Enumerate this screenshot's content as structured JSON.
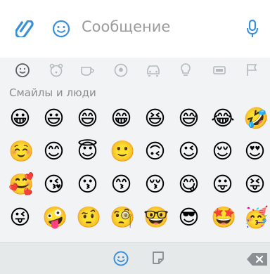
{
  "message_bar": {
    "placeholder": "Сообщение",
    "icons": [
      "paperclip-icon",
      "smile-icon",
      "microphone-icon"
    ],
    "accent_color": "#3a8fd9"
  },
  "categories": [
    {
      "name": "smileys",
      "active": true
    },
    {
      "name": "animals",
      "active": false
    },
    {
      "name": "food",
      "active": false
    },
    {
      "name": "activity",
      "active": false
    },
    {
      "name": "travel",
      "active": false
    },
    {
      "name": "objects",
      "active": false
    },
    {
      "name": "symbols",
      "active": false
    },
    {
      "name": "flags",
      "active": false
    }
  ],
  "section": {
    "title": "Смайлы и люди"
  },
  "emojis": [
    [
      "😀",
      "😃",
      "😄",
      "😁",
      "😆",
      "😅",
      "😂",
      "🤣"
    ],
    [
      "☺️",
      "😊",
      "😇",
      "🙂",
      "🙃",
      "😉",
      "😌",
      "😍"
    ],
    [
      "🥰",
      "😘",
      "😗",
      "😙",
      "😚",
      "😋",
      "😛",
      "😝"
    ],
    [
      "😜",
      "🤪",
      "🤨",
      "🧐",
      "🤓",
      "😎",
      "🤩",
      "🥳"
    ]
  ],
  "bottom_bar": {
    "icons": [
      "emoji-tab-icon",
      "sticker-tab-icon",
      "backspace-icon"
    ]
  }
}
